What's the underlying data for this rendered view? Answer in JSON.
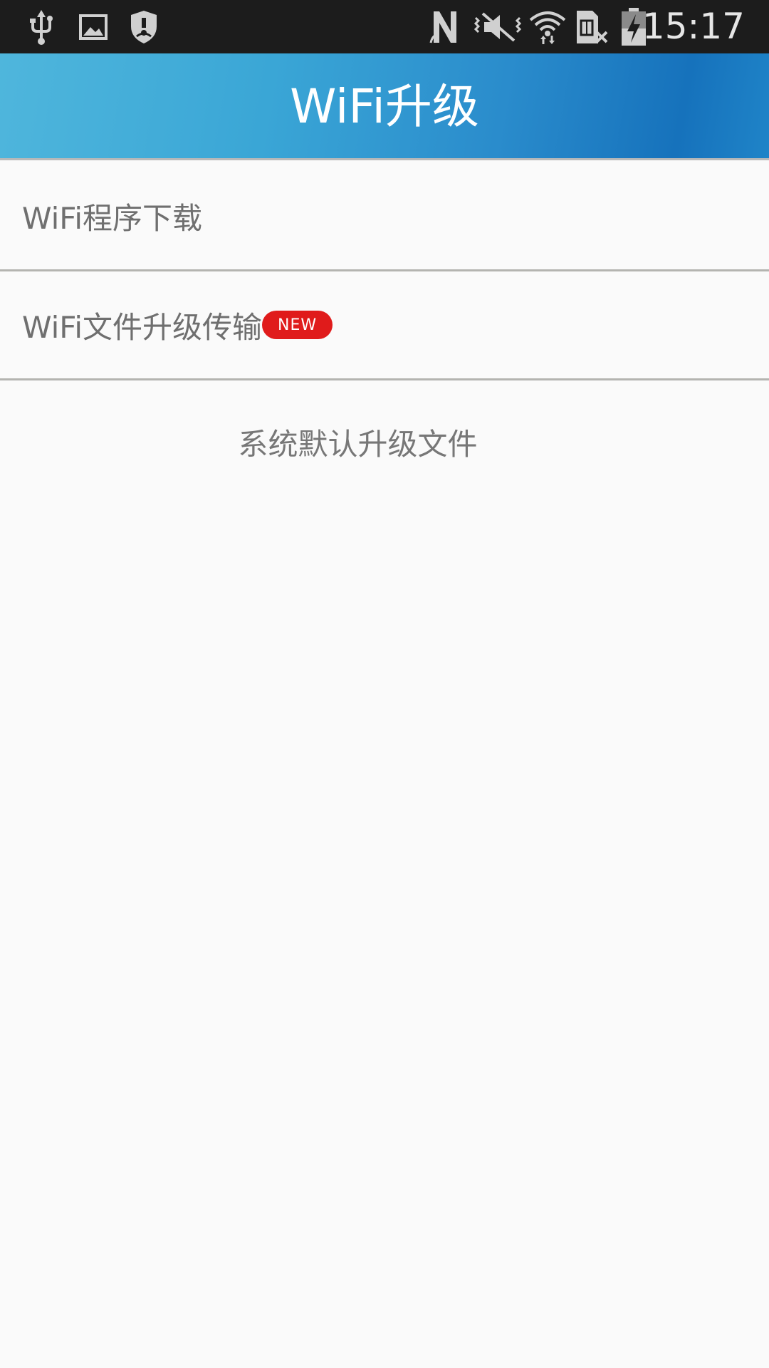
{
  "status_bar": {
    "time": "15:17",
    "left_icons": [
      "usb-icon",
      "image-notification-icon",
      "security-shield-icon"
    ],
    "right_icons": [
      "nfc-icon",
      "vibrate-mute-icon",
      "wifi-icon",
      "no-sim-icon",
      "battery-charging-icon"
    ]
  },
  "header": {
    "title": "WiFi升级",
    "gradient_colors": [
      "#4fb6dc",
      "#1672bc"
    ]
  },
  "menu": {
    "items": [
      {
        "label": "WiFi程序下载"
      },
      {
        "label": "WiFi文件升级传输",
        "badge": "NEW"
      }
    ]
  },
  "footer_link": {
    "label": "系统默认升级文件"
  },
  "colors": {
    "badge": "#e01b1b",
    "text": "#6f6f6f",
    "background": "#fafafa"
  }
}
